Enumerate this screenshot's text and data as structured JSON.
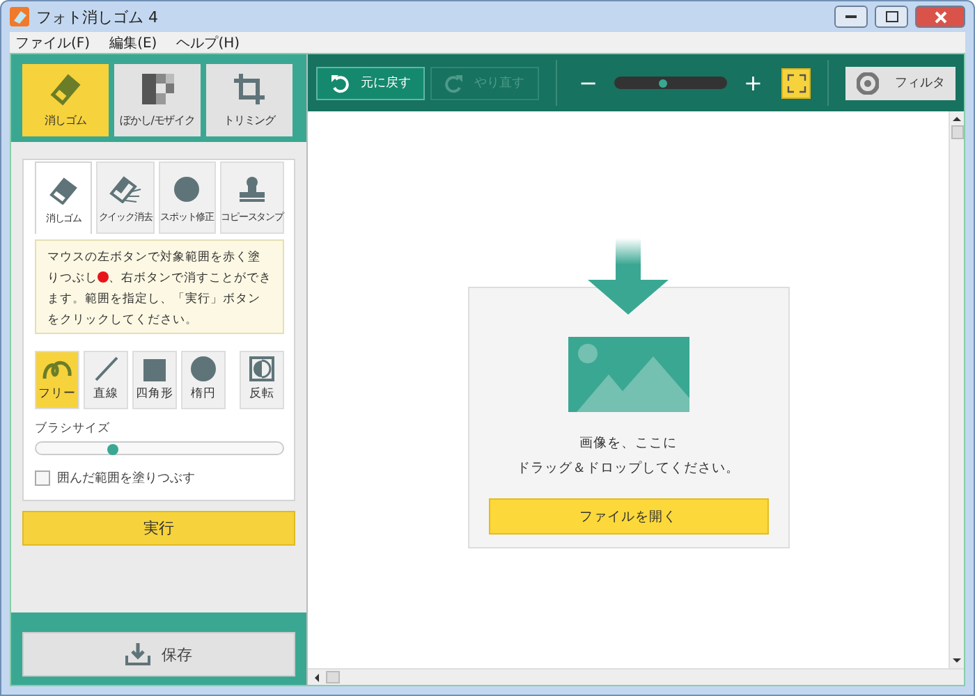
{
  "window": {
    "title": "フォト消しゴム 4"
  },
  "menu": [
    "ファイル(F)",
    "編集(E)",
    "ヘルプ(H)"
  ],
  "modes": [
    {
      "kind": "eraser",
      "label": "消しゴム",
      "selected": true
    },
    {
      "kind": "mosaic",
      "label": "ぼかし/モザイク",
      "selected": false
    },
    {
      "kind": "crop",
      "label": "トリミング",
      "selected": false
    }
  ],
  "tools": [
    {
      "kind": "eraser",
      "label": "消しゴム",
      "selected": true
    },
    {
      "kind": "quick",
      "label": "クイック消去",
      "selected": false
    },
    {
      "kind": "spot",
      "label": "スポット修正",
      "selected": false
    },
    {
      "kind": "stamp",
      "label": "コピースタンプ",
      "selected": false
    }
  ],
  "instructions": {
    "lead": "マウスの左ボタンで対象範囲を赤く塗りつぶし",
    "rest": "、右ボタンで消すことができます。範囲を指定し、「実行」ボタンをクリックしてください。"
  },
  "shapes": [
    {
      "kind": "free",
      "label": "フリー",
      "selected": true
    },
    {
      "kind": "line",
      "label": "直線",
      "selected": false
    },
    {
      "kind": "rect",
      "label": "四角形",
      "selected": false
    },
    {
      "kind": "ellipse",
      "label": "楕円",
      "selected": false
    },
    {
      "kind": "invert",
      "label": "反転",
      "selected": false
    }
  ],
  "brush": {
    "label": "ブラシサイズ",
    "level": 0.31
  },
  "fill_option": {
    "label": "囲んだ範囲を塗りつぶす",
    "checked": false
  },
  "execute_button": "実行",
  "save_button": "保存",
  "toolbar": {
    "undo": {
      "label": "元に戻す",
      "disabled": false
    },
    "redo": {
      "label": "やり直す",
      "disabled": true
    },
    "zoom_out": "−",
    "zoom_in": "+",
    "zoom": {
      "level": 0.43
    },
    "filter": "フィルタ"
  },
  "drop_area": {
    "lines": [
      "画像を、ここに",
      "ドラッグ＆ドロップしてください。"
    ],
    "open_button": "ファイルを開く"
  }
}
